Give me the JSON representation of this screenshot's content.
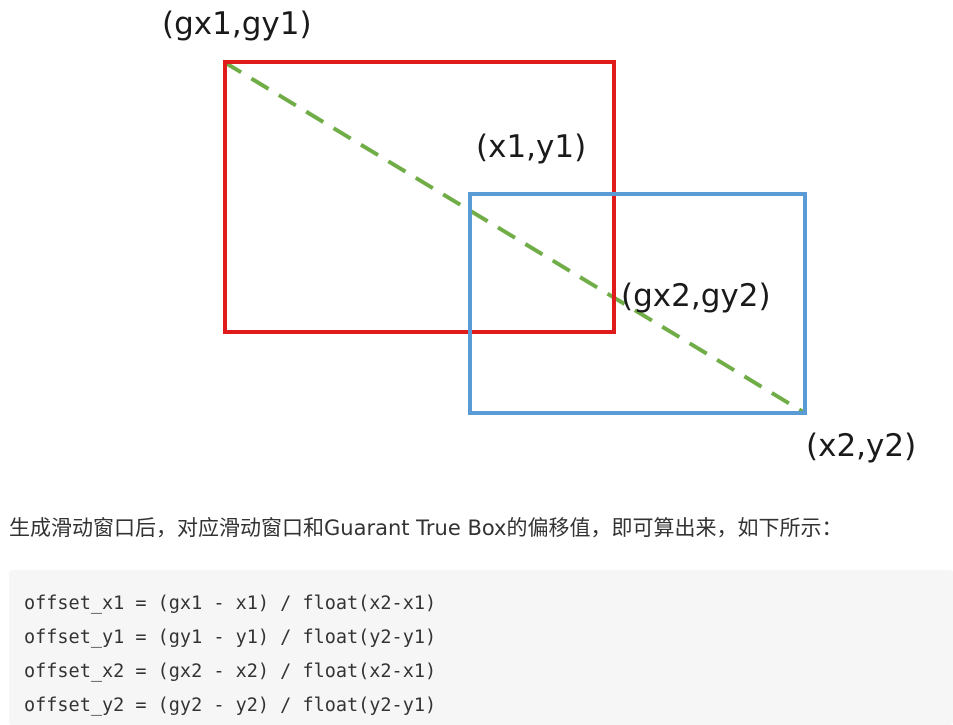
{
  "figure": {
    "labels": {
      "top_left_gt": "(gx1,gy1)",
      "top_left_win": "(x1,y1)",
      "bottom_right_gt": "(gx2,gy2)",
      "bottom_right_win": "(x2,y2)"
    },
    "colors": {
      "gt_box": "#e01b1b",
      "window_box": "#5b9bd5",
      "diagonal": "#70ad47"
    }
  },
  "paragraph": "生成滑动窗口后，对应滑动窗口和Guarant True Box的偏移值，即可算出来，如下所示：",
  "code": [
    "offset_x1 = (gx1 - x1) / float(x2-x1)",
    "offset_y1 = (gy1 - y1) / float(y2-y1)",
    "offset_x2 = (gx2 - x2) / float(x2-x1)",
    "offset_y2 = (gy2 - y2) / float(y2-y1)"
  ]
}
